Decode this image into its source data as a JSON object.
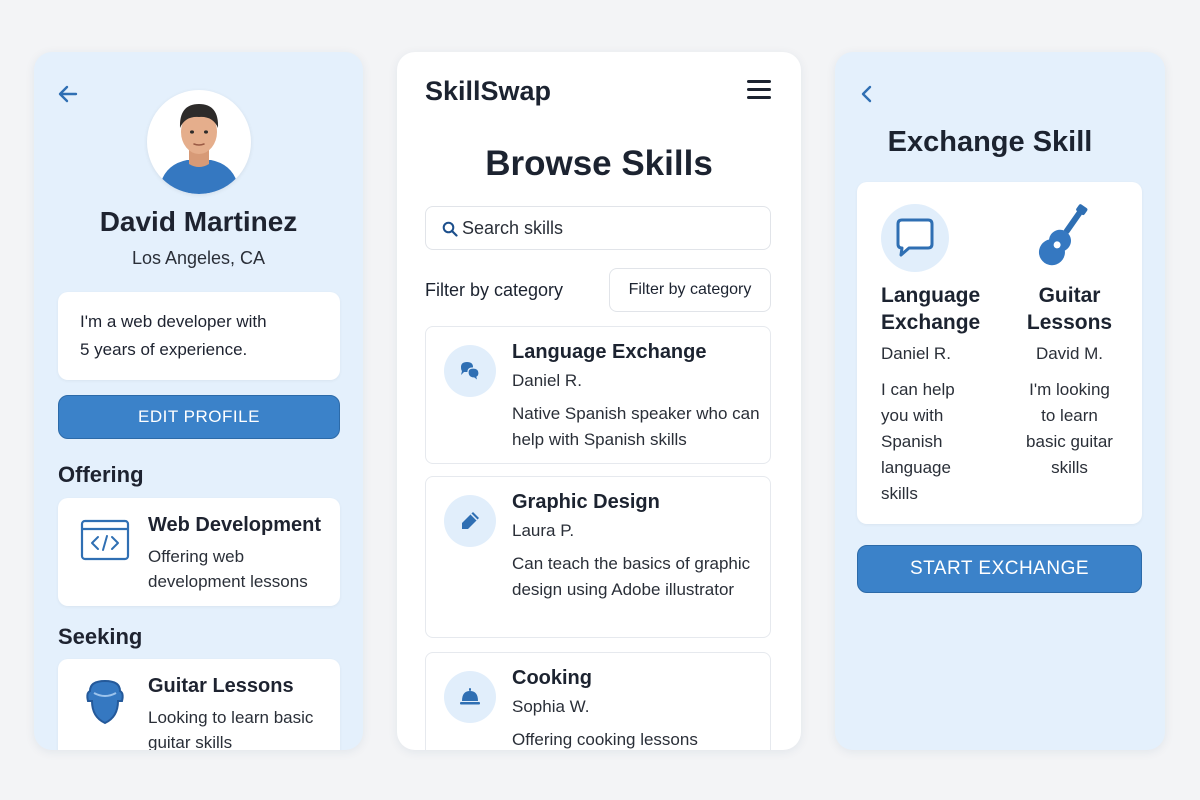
{
  "colors": {
    "accent": "#3b82c9",
    "panel_blue": "#e4f0fc",
    "icon_blue": "#2f6fb3"
  },
  "profile": {
    "back_icon": "arrow-left-icon",
    "name": "David Martinez",
    "location": "Los Angeles, CA",
    "bio_line1": "I'm a web developer with",
    "bio_line2": "5 years of experience.",
    "edit_button": "EDIT PROFILE",
    "offering_title": "Offering",
    "offering": {
      "icon": "code-window-icon",
      "title": "Web Development",
      "description": "Offering web development lessons"
    },
    "seeking_title": "Seeking",
    "seeking": {
      "icon": "guitar-icon",
      "title": "Guitar Lessons",
      "description": "Looking to learn basic guitar skills"
    }
  },
  "browse": {
    "app_name": "SkillSwap",
    "menu_icon": "hamburger-menu-icon",
    "title": "Browse Skills",
    "search_placeholder": "Search skills",
    "filter_label": "Filter by category",
    "filter_value": "Filter by category",
    "items": [
      {
        "icon": "chat-bubbles-icon",
        "title": "Language Exchange",
        "author": "Daniel R.",
        "description": "Native Spanish speaker who can help with Spanish skills"
      },
      {
        "icon": "pen-icon",
        "title": "Graphic Design",
        "author": "Laura P.",
        "description": "Can teach the basics of graphic design using Adobe illustrator"
      },
      {
        "icon": "cloche-icon",
        "title": "Cooking",
        "author": "Sophia W.",
        "description": "Offering cooking lessons"
      }
    ]
  },
  "exchange": {
    "back_icon": "chevron-left-icon",
    "title": "Exchange Skill",
    "left": {
      "icon": "chat-bubble-icon",
      "title_line1": "Language",
      "title_line2": "Exchange",
      "user": "Daniel R.",
      "description_lines": [
        "I can help",
        "you with",
        "Spanish",
        "language",
        "skills"
      ]
    },
    "right": {
      "icon": "guitar-icon",
      "title_line1": "Guitar",
      "title_line2": "Lessons",
      "user": "David M.",
      "description_lines": [
        "I'm looking",
        "to learn",
        "basic guitar",
        "skills"
      ]
    },
    "start_button": "START EXCHANGE"
  }
}
